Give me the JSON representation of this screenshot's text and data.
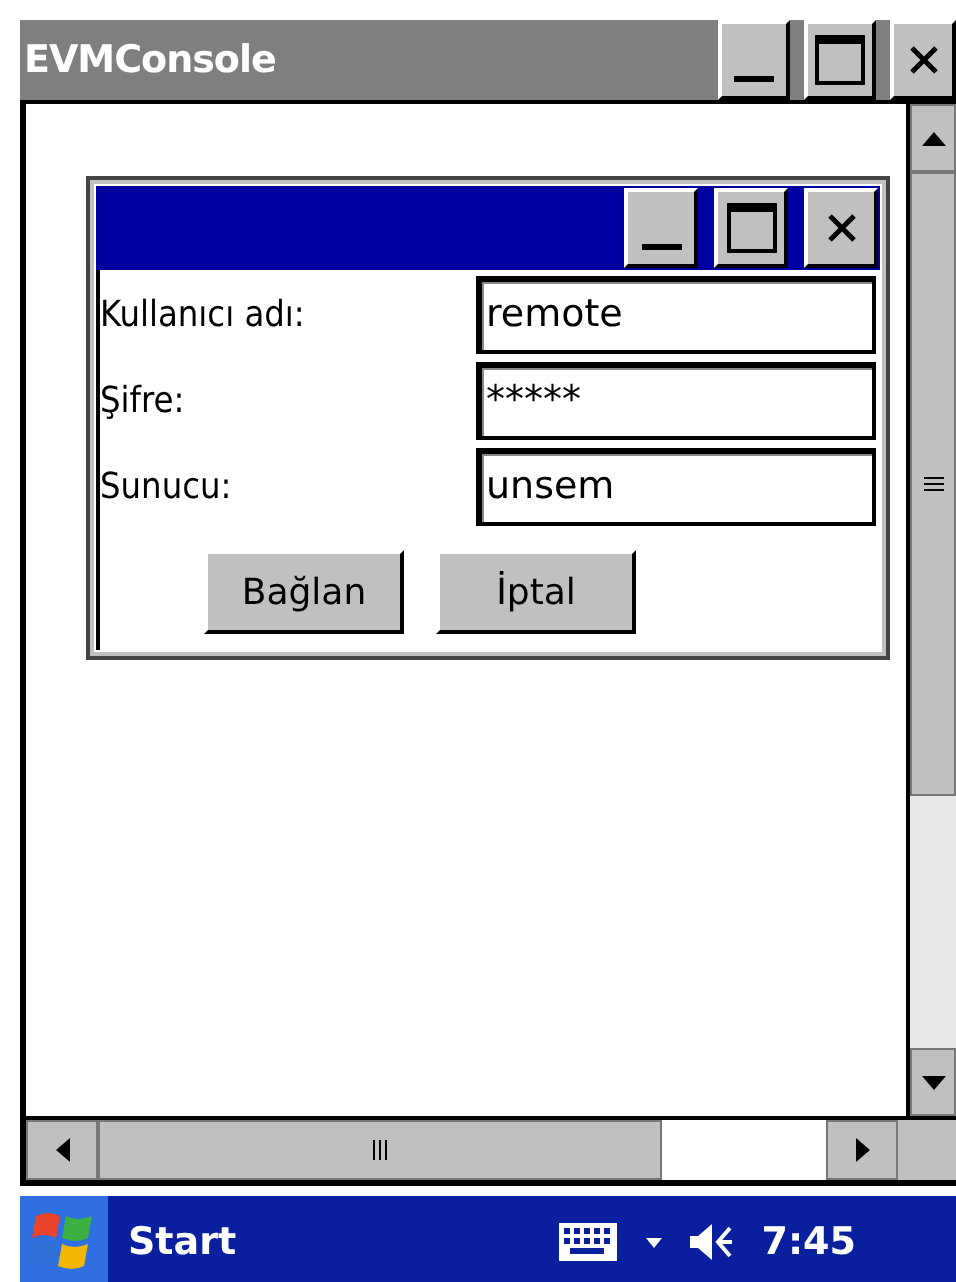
{
  "window": {
    "title": "EVMConsole"
  },
  "dialog": {
    "fields": [
      {
        "label": "Kullanıcı adı:",
        "value": "remote"
      },
      {
        "label": "Şifre:",
        "value": "*****"
      },
      {
        "label": "Sunucu:",
        "value": "unsem"
      }
    ],
    "buttons": [
      "Bağlan",
      "İptal"
    ]
  },
  "taskbar": {
    "start": "Start",
    "time": "7:45"
  }
}
